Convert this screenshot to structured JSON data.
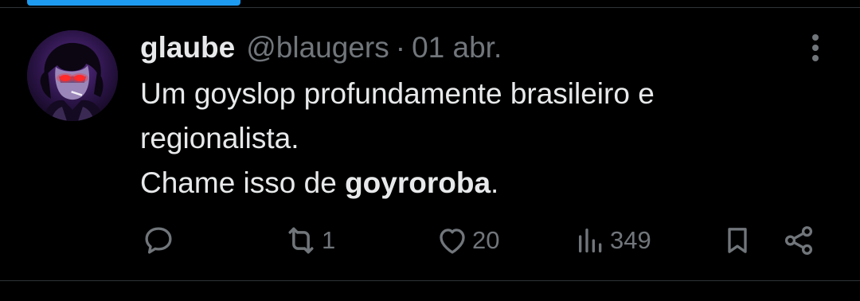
{
  "colors": {
    "background": "#000000",
    "text_primary": "#e7e9ea",
    "text_secondary": "#71767b",
    "accent": "#1d9bf0",
    "divider": "#2f3336"
  },
  "tweet": {
    "author_name": "glaube",
    "author_handle": "@blaugers",
    "separator": "·",
    "date": "01 abr.",
    "text_line1": "Um goyslop profundamente brasileiro e",
    "text_line2": "regionalista.",
    "text_line3_prefix": "Chame isso de ",
    "text_line3_bold": "goyroroba",
    "text_line3_suffix": "."
  },
  "actions": {
    "reply": {
      "icon": "reply-icon",
      "count": ""
    },
    "repost": {
      "icon": "repost-icon",
      "count": "1"
    },
    "like": {
      "icon": "heart-icon",
      "count": "20"
    },
    "views": {
      "icon": "views-icon",
      "count": "349"
    },
    "bookmark": {
      "icon": "bookmark-icon"
    },
    "share": {
      "icon": "share-icon"
    }
  },
  "more_menu": {
    "icon": "more-vertical-icon"
  }
}
